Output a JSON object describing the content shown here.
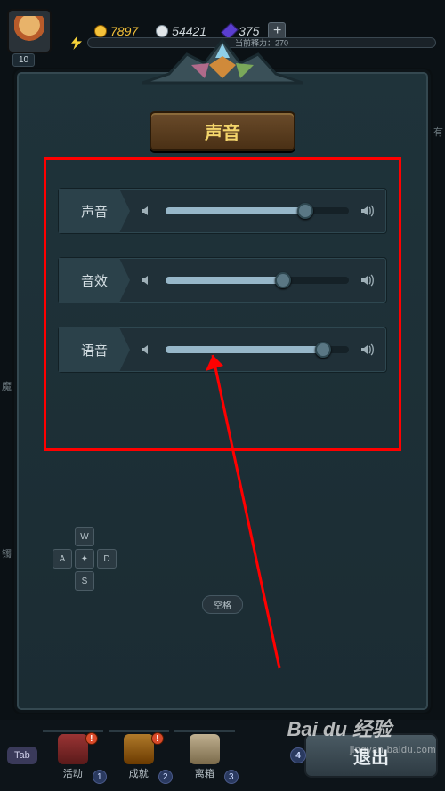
{
  "hud": {
    "level": "10",
    "gold": "7897",
    "silver": "54421",
    "gems": "375",
    "energy_label": "当前释力：270"
  },
  "modal": {
    "title": "声音",
    "sliders": [
      {
        "label": "声音",
        "value": 76
      },
      {
        "label": "音效",
        "value": 64
      },
      {
        "label": "语音",
        "value": 86
      }
    ]
  },
  "dpad": {
    "up": "W",
    "left": "A",
    "down": "S",
    "right": "D"
  },
  "space_key": "空格",
  "bottom": {
    "tab": "Tab",
    "items": [
      {
        "label": "活动",
        "key": "1",
        "alert": true
      },
      {
        "label": "成就",
        "key": "2",
        "alert": true
      },
      {
        "label": "离箱",
        "key": "3",
        "alert": false
      }
    ],
    "exit": {
      "label": "退出",
      "key": "4"
    }
  },
  "side": {
    "left1": "魔法",
    "left2": "镯子",
    "right1": "稀有"
  },
  "watermark": {
    "logo": "Bai du 经验",
    "url": "jingyan.baidu.com"
  }
}
